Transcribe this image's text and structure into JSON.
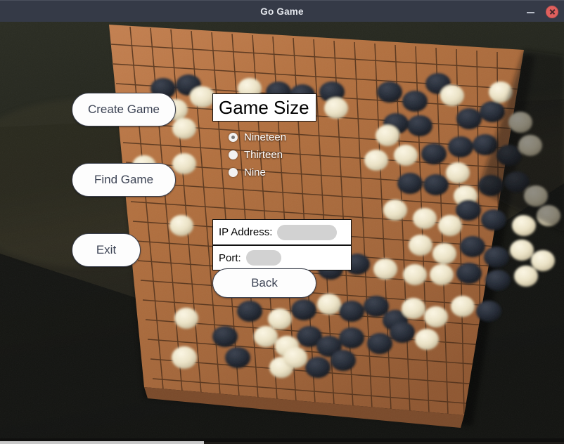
{
  "window": {
    "title": "Go Game",
    "minimize_icon": "minimize-icon",
    "close_icon": "close-icon",
    "titlebar_color": "#353a47"
  },
  "menu": {
    "create_game_label": "Create Game",
    "find_game_label": "Find Game",
    "exit_label": "Exit",
    "back_label": "Back"
  },
  "game_size": {
    "header": "Game Size",
    "selected": "Nineteen",
    "options": [
      {
        "label": "Nineteen",
        "checked": true
      },
      {
        "label": "Thirteen",
        "checked": false
      },
      {
        "label": "Nine",
        "checked": false
      }
    ]
  },
  "connection": {
    "ip_label": "IP Address:",
    "ip_value": "",
    "ip_placeholder": "",
    "port_label": "Port:",
    "port_value": "",
    "port_placeholder": ""
  },
  "background": {
    "description": "photo of a tilted wooden go board with black and white stones",
    "board_color": "#b2703f",
    "board_shadow_color": "#8a5530",
    "black_stone_color": "#20242e",
    "white_stone_color": "#ece5cc",
    "backdrop_color": "#20211a",
    "backdrop_dark_color": "#111210"
  }
}
